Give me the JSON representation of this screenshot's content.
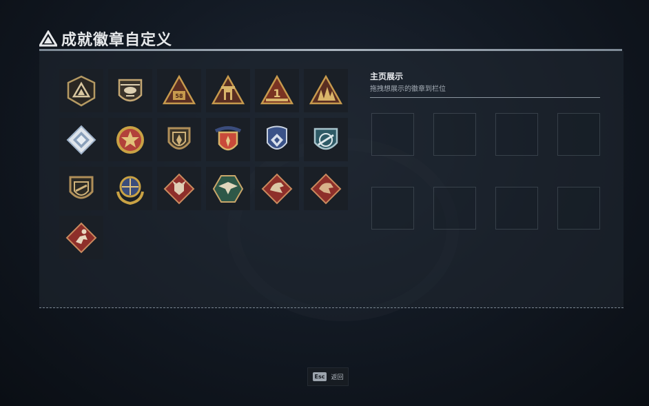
{
  "header": {
    "title": "成就徽章自定义",
    "icon": "delta-triangle-logo-icon"
  },
  "badges": [
    {
      "icon": "mountain-shield-badge-icon",
      "color": "#b59a63"
    },
    {
      "icon": "helicopter-shield-badge-icon",
      "color": "#c4a773"
    },
    {
      "icon": "triangle-58-badge-icon",
      "color": "#c79a4d"
    },
    {
      "icon": "triangle-tower-badge-icon",
      "color": "#c79a4d"
    },
    {
      "icon": "triangle-number-one-badge-icon",
      "color": "#c79a4d"
    },
    {
      "icon": "triangle-soldiers-badge-icon",
      "color": "#c79a4d"
    },
    {
      "icon": "blue-diamond-badge-icon",
      "color": "#9fb2c9"
    },
    {
      "icon": "red-star-medal-badge-icon",
      "color": "#b2413a"
    },
    {
      "icon": "gold-shield-badge-icon",
      "color": "#b08f59"
    },
    {
      "icon": "starred-crest-badge-icon",
      "color": "#c94a3a"
    },
    {
      "icon": "blue-crest-badge-icon",
      "color": "#3a5288"
    },
    {
      "icon": "teal-shield-rifle-badge-icon",
      "color": "#2e5a66"
    },
    {
      "icon": "rifle-shield-badge-icon",
      "color": "#b08f59"
    },
    {
      "icon": "crosshair-wreath-badge-icon",
      "color": "#c9a244"
    },
    {
      "icon": "wolf-diamond-badge-icon",
      "color": "#8e2f2a"
    },
    {
      "icon": "eagle-hexagon-badge-icon",
      "color": "#2e5848"
    },
    {
      "icon": "dragon-diamond-badge-icon",
      "color": "#8e2f2a"
    },
    {
      "icon": "dragon-diamond-badge-2-icon",
      "color": "#8e2f2a"
    },
    {
      "icon": "runner-diamond-badge-icon",
      "color": "#8e2f2a"
    }
  ],
  "showcase": {
    "title": "主页展示",
    "subtitle": "拖拽想展示的徽章到栏位",
    "slot_count": 8
  },
  "footer": {
    "key_label": "Esc",
    "action_label": "返回"
  }
}
